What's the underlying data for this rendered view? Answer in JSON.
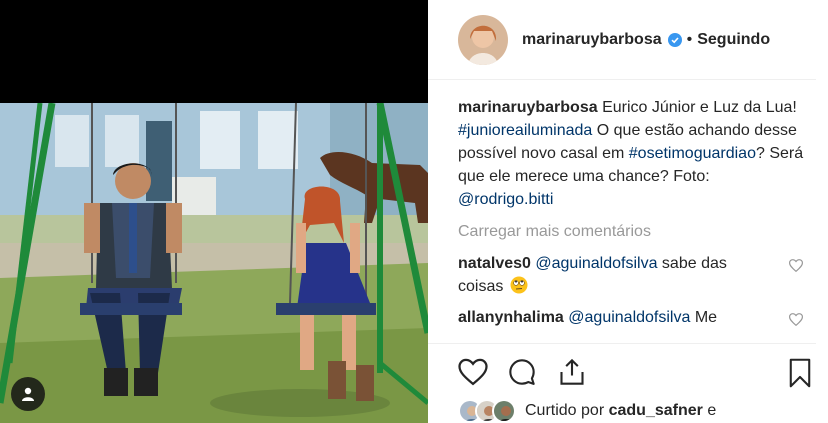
{
  "post": {
    "username": "marinaruybarbosa",
    "follow_separator": "•",
    "follow_status": "Seguindo",
    "caption_text": "Eurico Júnior e Luz da Lua!",
    "caption_hashtag1": "#junioreailuminada",
    "caption_line2": "O que estão achando desse possível novo casal em",
    "caption_hashtag2": "#osetimoguardiao",
    "caption_line3": "? Será que ele merece uma chance?",
    "caption_photo_label": "Foto:",
    "caption_photo_credit": "@rodrigo.bitti"
  },
  "comments_section": {
    "load_more": "Carregar mais comentários",
    "items": [
      {
        "username": "natalves0",
        "mention": "@aguinaldofsilva",
        "text": " sabe das coisas",
        "emoji": "rolling-eyes-emoji"
      },
      {
        "username": "allanynhalima",
        "mention": "@aguinaldofsilva",
        "text": " Me"
      }
    ]
  },
  "likes": {
    "label": "Curtido por",
    "user": "cadu_safner",
    "suffix": " e"
  },
  "icons": [
    "verified-badge-icon",
    "heart-icon",
    "comment-icon",
    "share-icon",
    "bookmark-icon",
    "user-tag-icon"
  ],
  "colors": {
    "link": "#003569",
    "verified": "#3897f0",
    "muted": "#999999",
    "text": "#262626"
  }
}
